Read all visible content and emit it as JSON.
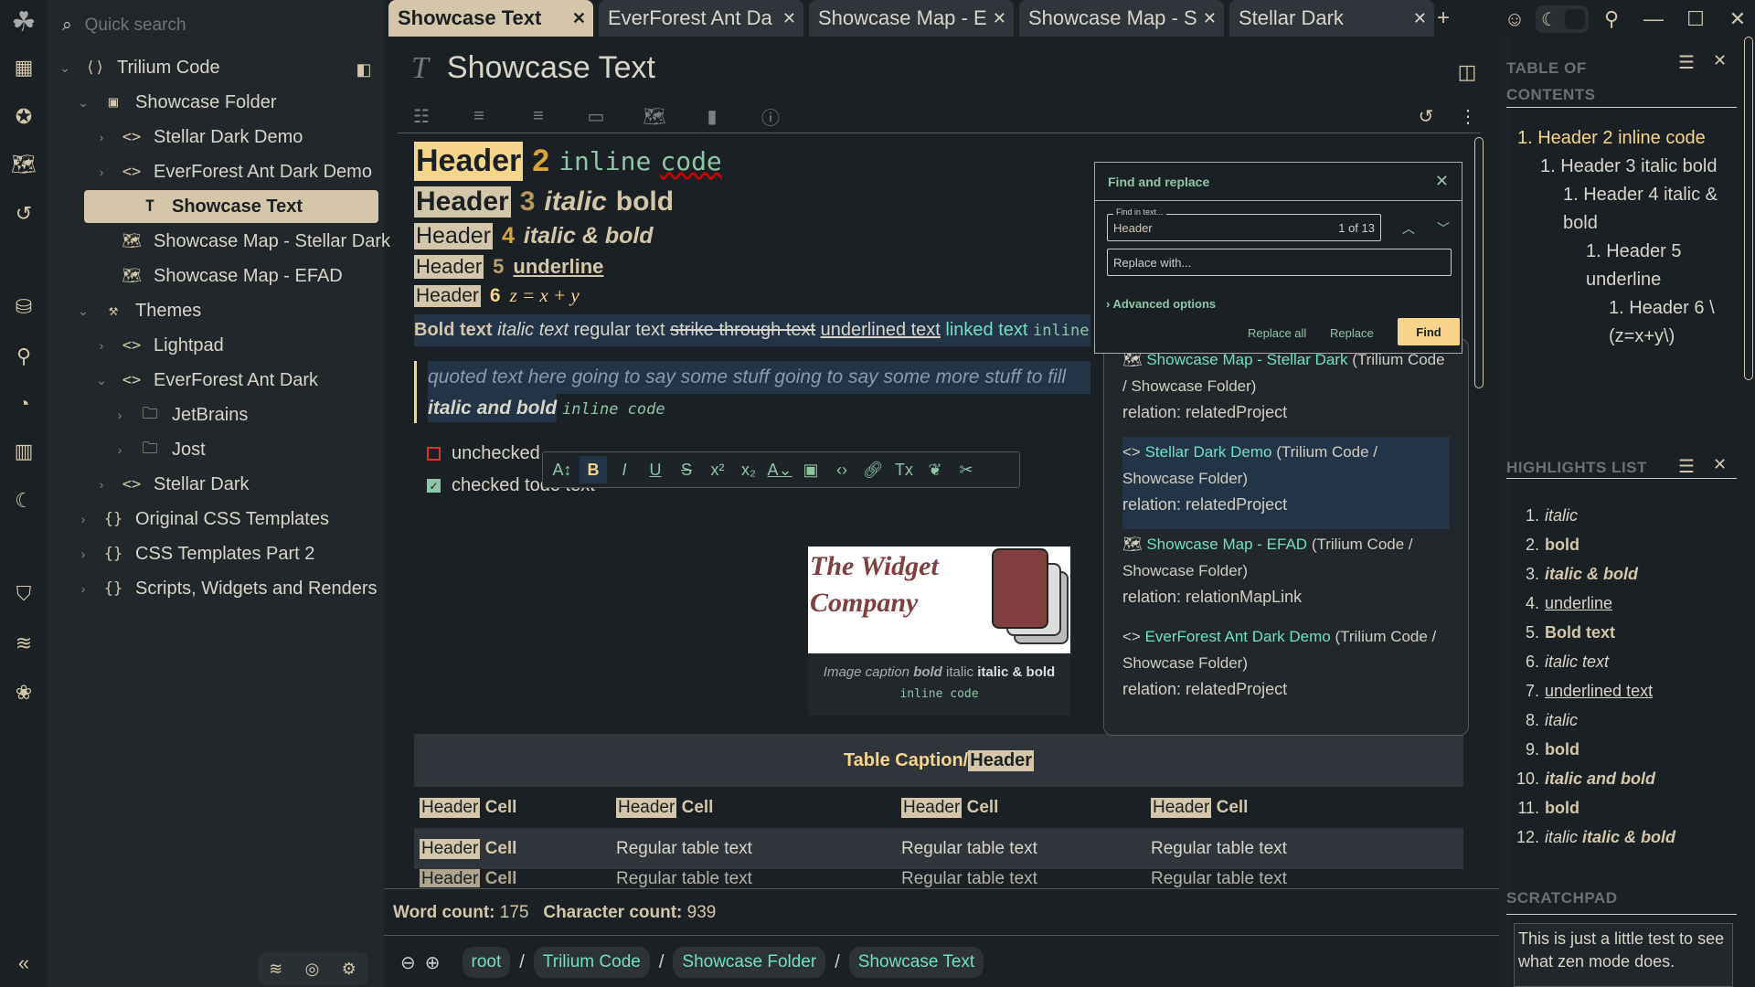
{
  "launcher": {
    "icons": [
      "trilium-logo-icon",
      "calendar-icon",
      "calendar-star-icon",
      "map-icon",
      "history-icon",
      "database-icon",
      "book-reader-icon",
      "dashboard-icon",
      "chart-icon",
      "moon-icon",
      "shield-check-icon",
      "wifi-icon",
      "lotus-icon",
      "collapse-icon"
    ]
  },
  "tree": {
    "search_placeholder": "Quick search",
    "items": [
      {
        "label": "Trilium Code",
        "icon": "code-box-icon",
        "chev": "v",
        "level": 0
      },
      {
        "label": "Showcase Folder",
        "icon": "presentation-icon",
        "chev": "v",
        "level": 1
      },
      {
        "label": "Stellar Dark Demo",
        "icon": "code-icon",
        "chev": ">",
        "level": 2
      },
      {
        "label": "EverForest Ant Dark Demo",
        "icon": "code-icon",
        "chev": ">",
        "level": 2
      },
      {
        "label": "Showcase Text",
        "icon": "text-icon",
        "chev": "",
        "level": 2,
        "active": true
      },
      {
        "label": "Showcase Map - Stellar Dark",
        "icon": "map-icon",
        "chev": "",
        "level": 2
      },
      {
        "label": "Showcase Map - EFAD",
        "icon": "map-icon",
        "chev": "",
        "level": 2
      },
      {
        "label": "Themes",
        "icon": "paint-roller-icon",
        "chev": "v",
        "level": 1
      },
      {
        "label": "Lightpad",
        "icon": "code-icon",
        "chev": ">",
        "level": 2
      },
      {
        "label": "EverForest Ant Dark",
        "icon": "code-icon",
        "chev": "v",
        "level": 2
      },
      {
        "label": "JetBrains",
        "icon": "folder-icon",
        "chev": ">",
        "level": 3
      },
      {
        "label": "Jost",
        "icon": "folder-icon",
        "chev": ">",
        "level": 3
      },
      {
        "label": "Stellar Dark",
        "icon": "code-icon",
        "chev": ">",
        "level": 2
      },
      {
        "label": "Original CSS Templates",
        "icon": "braces-icon",
        "chev": ">",
        "level": 1
      },
      {
        "label": "CSS Templates Part 2",
        "icon": "braces-icon",
        "chev": ">",
        "level": 1
      },
      {
        "label": "Scripts, Widgets and Renders",
        "icon": "braces-icon",
        "chev": ">",
        "level": 1
      }
    ]
  },
  "tabs": [
    {
      "label": "Showcase Text",
      "active": true
    },
    {
      "label": "EverForest Ant Da"
    },
    {
      "label": "Showcase Map - E"
    },
    {
      "label": "Showcase Map - S"
    },
    {
      "label": "Stellar Dark"
    }
  ],
  "note": {
    "title": "Showcase Text"
  },
  "content": {
    "h2": {
      "hl": "Header",
      "num": "2",
      "code1": "inline",
      "code2": "code"
    },
    "h3": {
      "hl": "Header",
      "num": "3",
      "i": "italic",
      "b": "bold"
    },
    "h4": {
      "hl": "Header",
      "num": "4",
      "ib": "italic & bold"
    },
    "h5": {
      "hl": "Header",
      "num": "5",
      "u": "underline"
    },
    "h6": {
      "hl": "Header",
      "num": "6",
      "math": "z = x + y"
    },
    "para": {
      "bold": "Bold text",
      "italic": "italic text",
      "regular": "regular text",
      "strike": "strike through text",
      "underline": "underlined text",
      "link": "linked text",
      "code": "inline"
    },
    "quote": {
      "text": "quoted text here going to say some stuff going to say some more stuff to fill",
      "ib": "italic and bold",
      "code": "inline code"
    },
    "todo": [
      {
        "label": "unchecked",
        "checked": false
      },
      {
        "label": "checked todo text",
        "checked": true
      }
    ],
    "image": {
      "logo_text": "The Widget Company",
      "caption_pre": "Image caption",
      "caption_bold": "bold",
      "caption_italic": "italic",
      "caption_ib": "italic & bold",
      "caption_code": "inline code"
    },
    "table": {
      "caption": "Table Caption/",
      "caption_hl": "Header",
      "header_hl": "Header",
      "header_cell": "Cell",
      "regular": "Regular table text"
    }
  },
  "find": {
    "title": "Find and replace",
    "find_label": "Find in text...",
    "find_value": "Header",
    "count": "1 of 13",
    "replace_placeholder": "Replace with...",
    "advanced": "Advanced options",
    "replace_all": "Replace all",
    "replace": "Replace",
    "find_btn": "Find"
  },
  "relations": [
    {
      "title": "Showcase Map - Stellar Dark",
      "path": "(Trilium Code / Showcase Folder)",
      "relation": "relation: relatedProject",
      "icon": "map-icon"
    },
    {
      "title": "Stellar Dark Demo",
      "path": "(Trilium Code / Showcase Folder)",
      "relation": "relation: relatedProject",
      "icon": "code-icon"
    },
    {
      "title": "Showcase Map - EFAD",
      "path": "(Trilium Code / Showcase Folder)",
      "relation": "relation: relationMapLink",
      "icon": "map-icon"
    },
    {
      "title": "EverForest Ant Dark Demo",
      "path": "(Trilium Code / Showcase Folder)",
      "relation": "relation: relatedProject",
      "icon": "code-icon"
    }
  ],
  "status": {
    "word_label": "Word count:",
    "word": "175",
    "char_label": "Character count:",
    "char": "939"
  },
  "breadcrumb": [
    "root",
    "Trilium Code",
    "Showcase Folder",
    "Showcase Text"
  ],
  "toc": {
    "title": "TABLE OF CONTENTS",
    "items": [
      "1. Header 2 inline code",
      "1. Header 3 italic bold",
      "1. Header 4 italic & bold",
      "1. Header 5 underline",
      "1. Header 6 \\(z=x+y\\)"
    ]
  },
  "highlights": {
    "title": "HIGHLIGHTS LIST",
    "items": [
      "italic",
      "bold",
      "italic & bold",
      "underline",
      "Bold text",
      "italic text",
      "underlined text",
      "italic",
      "bold",
      "italic and bold",
      "bold",
      "italic",
      "italic & bold"
    ]
  },
  "scratchpad": {
    "title": "SCRATCHPAD",
    "text": "This is just a little test to see what zen mode does."
  },
  "colors": {
    "accent": "#d3c6aa",
    "gold": "#f5d48c",
    "link": "#6ee0c0",
    "code": "#8fc5a5",
    "bg": "#1b2024"
  }
}
